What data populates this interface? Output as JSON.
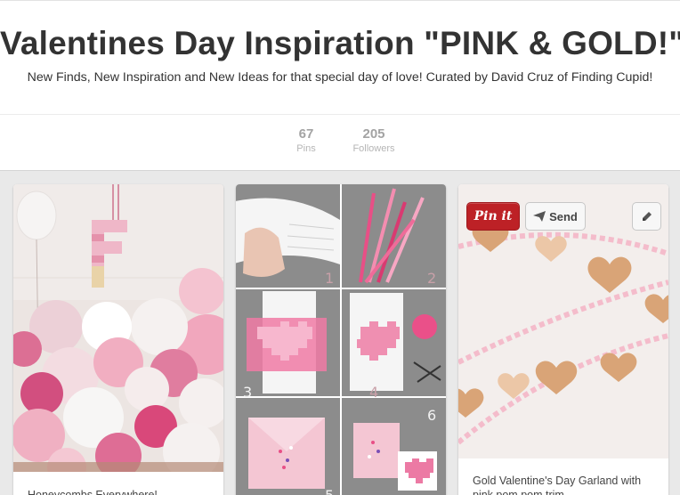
{
  "board": {
    "title": "Valentines Day Inspiration \"PINK & GOLD!\"",
    "description": "New Finds, New Inspiration and New Ideas for that special day of love! Curated by David Cruz of Finding Cupid!"
  },
  "stats": {
    "pins_count": "67",
    "pins_label": "Pins",
    "followers_count": "205",
    "followers_label": "Followers"
  },
  "pins": [
    {
      "caption": "Honeycombs Everywhere!"
    },
    {
      "caption": "",
      "step_numbers": [
        "1",
        "2",
        "3",
        "4",
        "5",
        "6"
      ]
    },
    {
      "caption": "Gold Valentine's Day Garland with pink pom pom trim"
    }
  ],
  "pin_actions": {
    "pin_it_label": "Pin it",
    "send_label": "Send"
  },
  "icons": {
    "send": "paper-plane-icon",
    "edit": "pencil-icon"
  },
  "colors": {
    "pin_it_red": "#bd2126",
    "background": "#e9e9e9",
    "accent_pink": "#e98fb0"
  }
}
